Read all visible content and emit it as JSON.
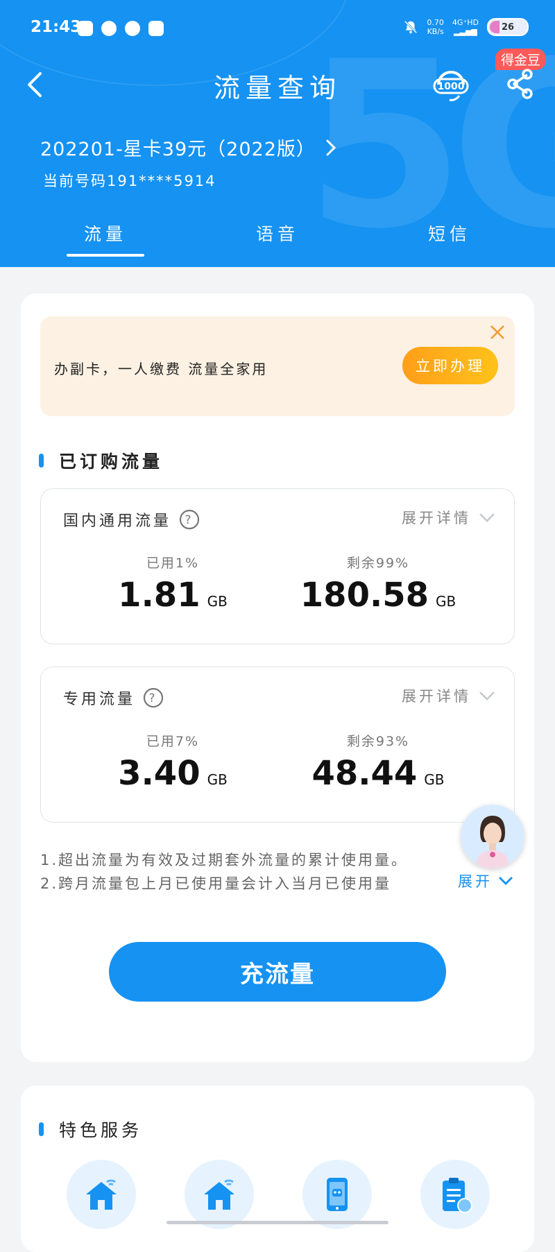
{
  "status_bar": {
    "time": "21:43",
    "net_speed_value": "0.70",
    "net_speed_unit": "KB/s",
    "network": "4G⁺HD",
    "battery": "26"
  },
  "header": {
    "title": "流量查询",
    "badge": "得金豆",
    "plan_name": "202201-星卡39元（2022版）",
    "phone_label": "当前号码191****5914",
    "tabs": [
      "流量",
      "语音",
      "短信"
    ],
    "active_tab": "流量"
  },
  "promo": {
    "text": "办副卡，一人缴费 流量全家用",
    "button": "立即办理"
  },
  "subscribed": {
    "title": "已订购流量",
    "packages": [
      {
        "name": "国内通用流量",
        "expand_label": "展开详情",
        "used_label": "已用1%",
        "used_value": "1.81",
        "used_unit": "GB",
        "remain_label": "剩余99%",
        "remain_value": "180.58",
        "remain_unit": "GB"
      },
      {
        "name": "专用流量",
        "expand_label": "展开详情",
        "used_label": "已用7%",
        "used_value": "3.40",
        "used_unit": "GB",
        "remain_label": "剩余93%",
        "remain_value": "48.44",
        "remain_unit": "GB"
      }
    ]
  },
  "notes": {
    "line1": "1.超出流量为有效及过期套外流量的累计使用量。",
    "line2": "2.跨月流量包上月已使用量会计入当月已使用量",
    "expand_label": "展开"
  },
  "recharge_button": "充流量",
  "features": {
    "title": "特色服务",
    "icons": [
      "home-wifi-icon",
      "home-wifi-icon",
      "phone-robot-icon",
      "clipboard-icon"
    ]
  },
  "colors": {
    "brand_blue": "#1592f2",
    "promo_bg": "#fcf1e3",
    "promo_button": "#ffb01a",
    "badge_red": "#ff5a5a"
  }
}
